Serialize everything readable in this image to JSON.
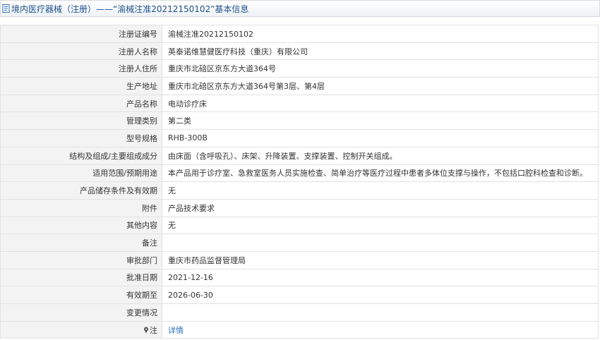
{
  "header": {
    "title": "境内医疗器械（注册）——“渝械注准20212150102”基本信息"
  },
  "fields": [
    {
      "label": "注册证编号",
      "value": "渝械注准20212150102"
    },
    {
      "label": "注册人名称",
      "value": "英泰诺维慧健医疗科技（重庆）有限公司"
    },
    {
      "label": "注册人住所",
      "value": "重庆市北碚区京东方大道364号"
    },
    {
      "label": "生产地址",
      "value": "重庆市北碚区京东方大道364号第3层、第4层"
    },
    {
      "label": "产品名称",
      "value": "电动诊疗床"
    },
    {
      "label": "管理类别",
      "value": "第二类"
    },
    {
      "label": "型号规格",
      "value": "RHB-300B"
    },
    {
      "label": "结构及组成/主要组成成分",
      "value": "由床面（含呼吸孔）、床架、升降装置、支撑装置、控制开关组成。"
    },
    {
      "label": "适用范围/预期用途",
      "value": "本产品用于诊疗室、急救室医务人员实施检查、简单治疗等医疗过程中患者多体位支撑与操作，不包括口腔科检查和诊断。"
    },
    {
      "label": "产品储存条件及有效期",
      "value": "无"
    },
    {
      "label": "附件",
      "value": "产品技术要求"
    },
    {
      "label": "其他内容",
      "value": "无"
    },
    {
      "label": "备注",
      "value": ""
    },
    {
      "label": "审批部门",
      "value": "重庆市药品监督管理局"
    },
    {
      "label": "批准日期",
      "value": "2021-12-16"
    },
    {
      "label": "有效期至",
      "value": "2026-06-30"
    },
    {
      "label": "变更情况",
      "value": ""
    }
  ],
  "note_row": {
    "label": "注",
    "link": "详情",
    "icon": "pin-icon"
  },
  "colors": {
    "header_text": "#1f4f8b",
    "label_bg": "#f3f3f3",
    "border": "#e2e2e2",
    "link": "#2a6ebb"
  }
}
